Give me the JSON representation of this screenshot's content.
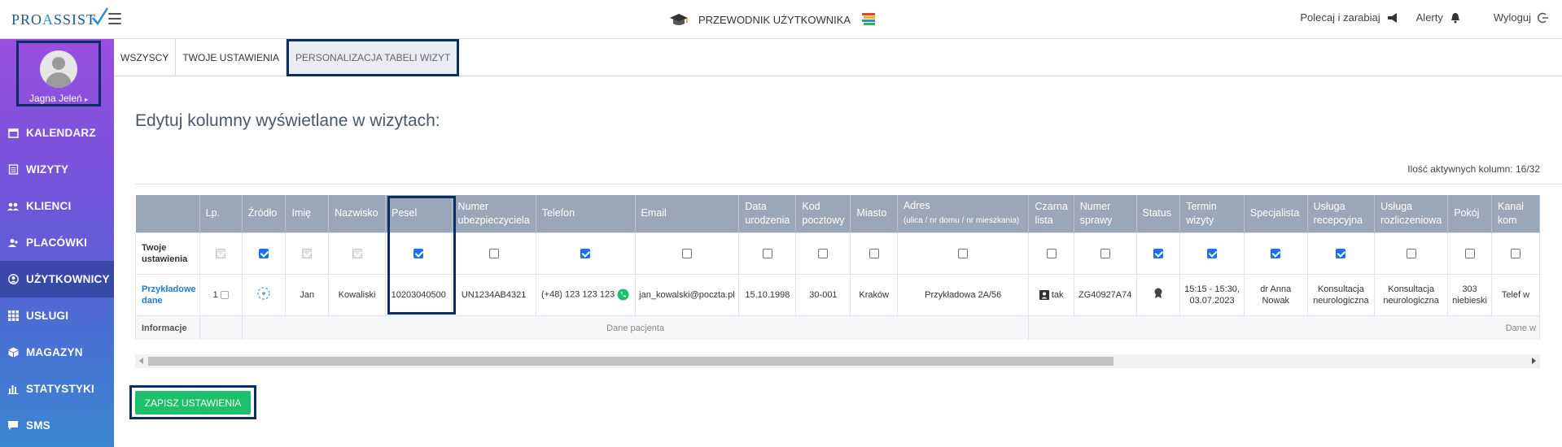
{
  "logo": {
    "part1": "PRO",
    "part2": "A",
    "part3": "SSIST"
  },
  "guide": {
    "label": "PRZEWODNIK UŻYTKOWNIKA"
  },
  "topright": {
    "refer": "Polecaj i zarabiaj",
    "alerts": "Alerty",
    "logout": "Wyloguj"
  },
  "user": {
    "name": "Jagna Jeleń"
  },
  "sidebar": {
    "items": [
      {
        "label": "KALENDARZ",
        "icon": "calendar-icon"
      },
      {
        "label": "WIZYTY",
        "icon": "document-icon"
      },
      {
        "label": "KLIENCI",
        "icon": "users-icon"
      },
      {
        "label": "PLACÓWKI",
        "icon": "user-plus-icon"
      },
      {
        "label": "UŻYTKOWNICY",
        "icon": "user-circle-icon"
      },
      {
        "label": "USŁUGI",
        "icon": "grid-icon"
      },
      {
        "label": "MAGAZYN",
        "icon": "box-icon"
      },
      {
        "label": "STATYSTYKI",
        "icon": "bar-chart-icon"
      },
      {
        "label": "SMS",
        "icon": "chat-icon"
      }
    ]
  },
  "tabs": [
    {
      "label": "WSZYSCY"
    },
    {
      "label": "TWOJE USTAWIENIA"
    },
    {
      "label": "PERSONALIZACJA TABELI WIZYT"
    }
  ],
  "main": {
    "heading": "Edytuj kolumny wyświetlane w wizytach:",
    "active_count": "Ilość aktywnych kolumn: 16/32",
    "save_label": "ZAPISZ USTAWIENIA"
  },
  "table": {
    "headers": [
      {
        "label": ""
      },
      {
        "label": "Lp."
      },
      {
        "label": "Źródło"
      },
      {
        "label": "Imię"
      },
      {
        "label": "Nazwisko"
      },
      {
        "label": "Pesel"
      },
      {
        "label": "Numer ubezpieczyciela"
      },
      {
        "label": "Telefon"
      },
      {
        "label": "Email"
      },
      {
        "label": "Data urodzenia"
      },
      {
        "label": "Kod pocztowy"
      },
      {
        "label": "Miasto"
      },
      {
        "label": "Adres",
        "sub": "(ulica / nr domu / nr mieszkania)"
      },
      {
        "label": "Czarna lista"
      },
      {
        "label": "Numer sprawy"
      },
      {
        "label": "Status"
      },
      {
        "label": "Termin wizyty"
      },
      {
        "label": "Specjalista"
      },
      {
        "label": "Usługa recepcyjna"
      },
      {
        "label": "Usługa rozliczeniowa"
      },
      {
        "label": "Pokój"
      },
      {
        "label": "Kanał kom"
      }
    ],
    "settings_label": "Twoje ustawienia",
    "settings": [
      "dis",
      "on",
      "dis",
      "dis",
      "on",
      "off",
      "on",
      "off",
      "off",
      "off",
      "off",
      "off",
      "off",
      "off",
      "on",
      "on",
      "on",
      "on",
      "off",
      "off",
      "off"
    ],
    "sample_label": "Przykładowe dane",
    "sample": {
      "lp": "1",
      "imie": "Jan",
      "nazwisko": "Kowaliski",
      "pesel": "10203040500",
      "ubezp": "UN1234AB4321",
      "telefon": "(+48) 123 123 123",
      "email": "jan_kowalski@poczta.pl",
      "urodzenie": "15.10.1998",
      "kod": "30-001",
      "miasto": "Kraków",
      "adres": "Przykładowa 2A/56",
      "czarna": "tak",
      "sprawa": "ZG40927A74",
      "termin": "15:15 - 15:30, 03.07.2023",
      "specjalista": "dr Anna Nowak",
      "recepcyjna": "Konsultacja neurologiczna",
      "rozliczeniowa": "Konsultacja neurologiczna",
      "pokoj": "303 niebieski",
      "kanal": "Telef w"
    },
    "info_label": "Informacje",
    "info_patient": "Dane pacjenta",
    "info_visit": "Dane w"
  }
}
